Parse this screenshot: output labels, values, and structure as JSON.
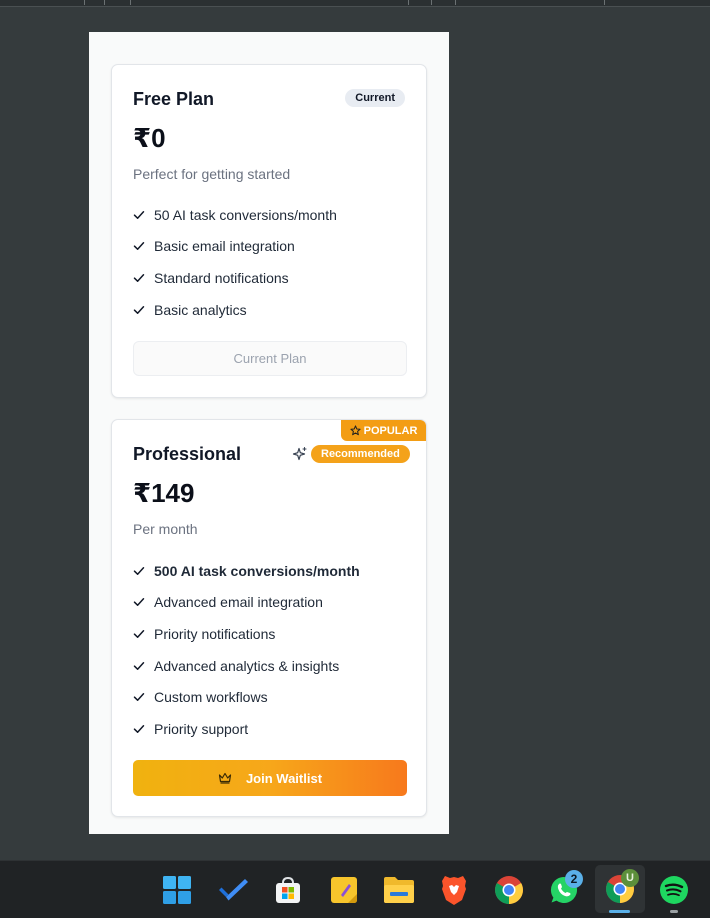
{
  "free_plan": {
    "name": "Free Plan",
    "badge": "Current",
    "price": "₹0",
    "subtitle": "Perfect for getting started",
    "features": [
      "50 AI task conversions/month",
      "Basic email integration",
      "Standard notifications",
      "Basic analytics"
    ],
    "button_label": "Current Plan"
  },
  "pro_plan": {
    "name": "Professional",
    "ribbon": "POPULAR",
    "badge": "Recommended",
    "price": "₹149",
    "subtitle": "Per month",
    "features": [
      "500 AI task conversions/month",
      "Advanced email integration",
      "Priority notifications",
      "Advanced analytics & insights",
      "Custom workflows",
      "Priority support"
    ],
    "button_label": "Join Waitlist"
  },
  "taskbar": {
    "whatsapp_badge": "2",
    "chrome_profile_badge": "U",
    "icons": [
      "windows-start-icon",
      "todo-icon",
      "ms-store-icon",
      "sticky-notes-icon",
      "file-explorer-icon",
      "brave-icon",
      "chrome-icon",
      "whatsapp-icon",
      "chrome-profile-icon",
      "spotify-icon"
    ]
  },
  "colors": {
    "accent_orange": "#f39d14",
    "button_gradient_start": "#f0b20f",
    "button_gradient_end": "#f7791c",
    "panel_bg": "#f9fafa",
    "desktop_bg": "#353b3d"
  }
}
